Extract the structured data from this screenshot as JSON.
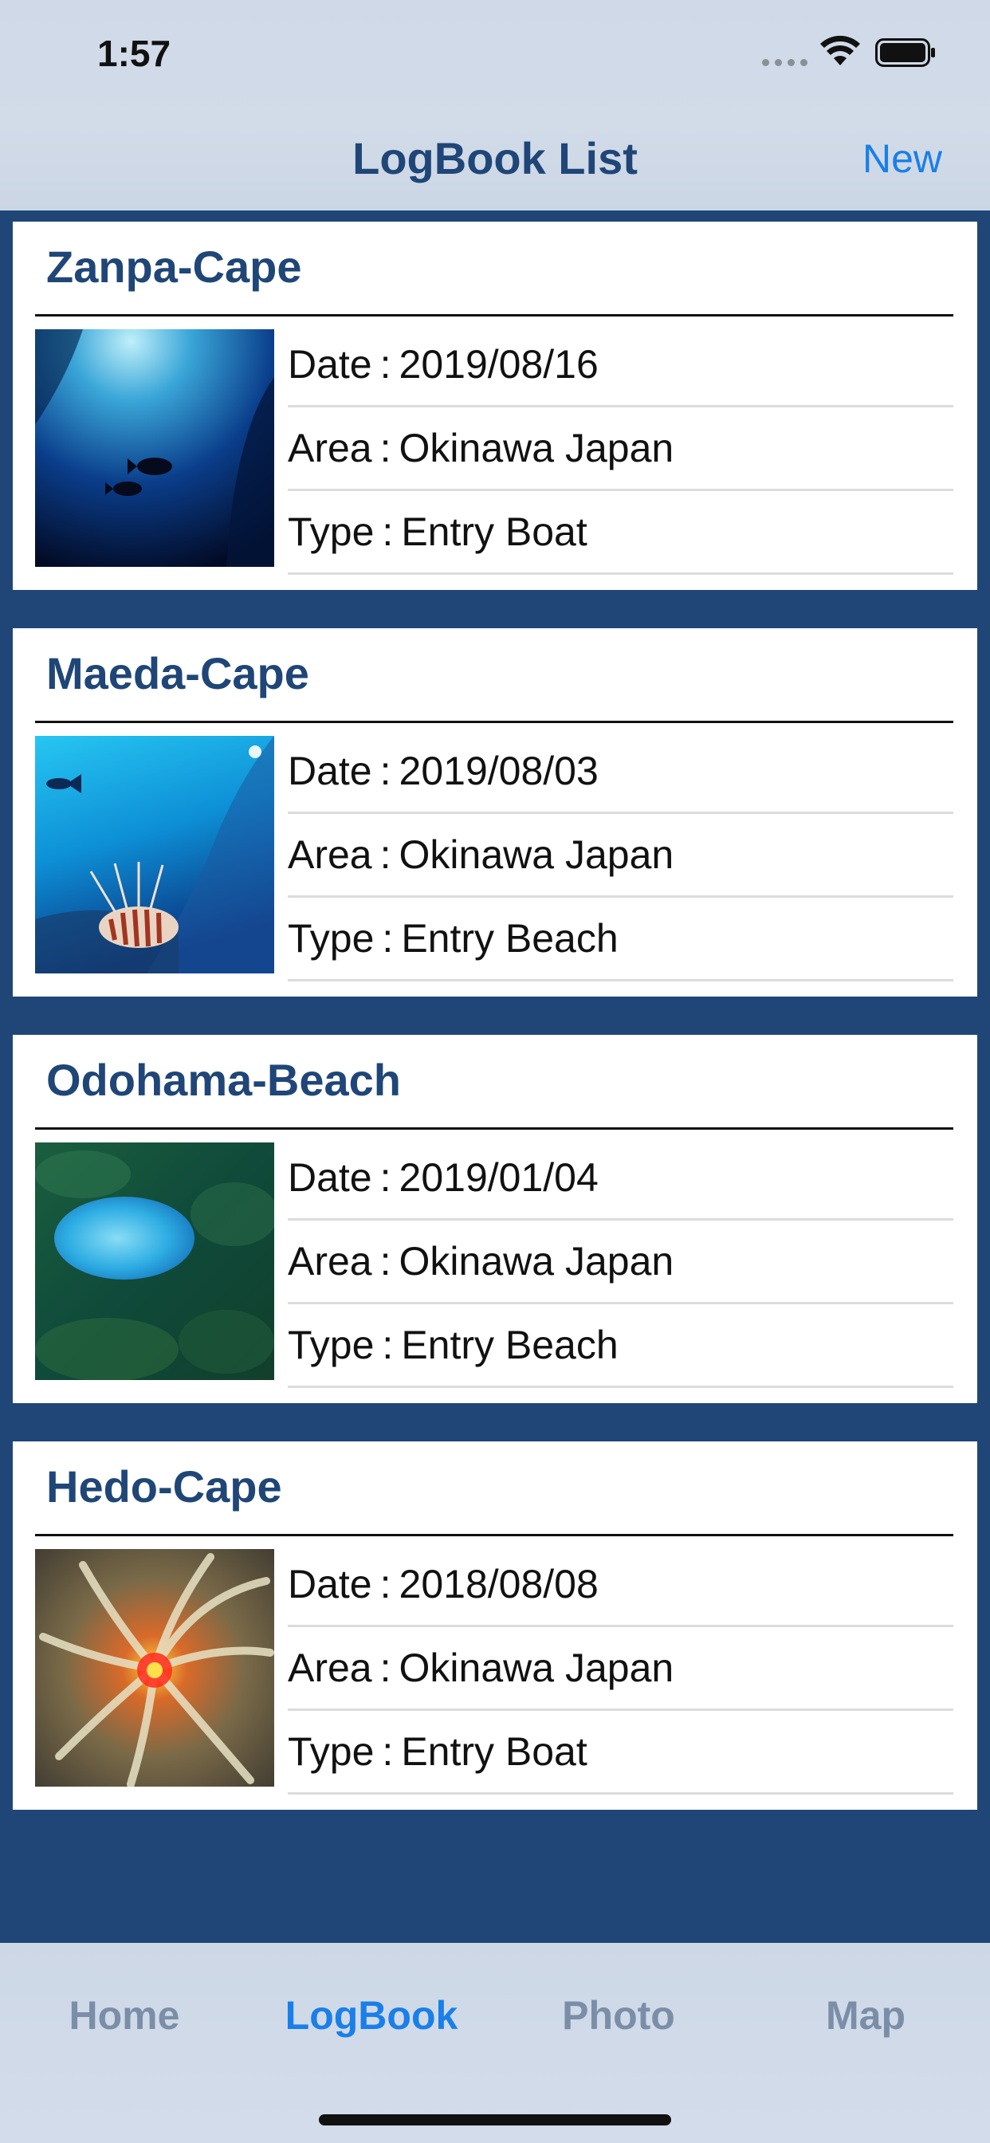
{
  "status_bar": {
    "time": "1:57"
  },
  "nav": {
    "title": "LogBook List",
    "new_label": "New"
  },
  "logs": [
    {
      "name": "Zanpa-Cape",
      "date_label": "Date",
      "date": "2019/08/16",
      "area_label": "Area",
      "area": "Okinawa Japan",
      "type_label": "Type",
      "type": "Entry Boat",
      "photo": "fish-silhouettes-photo"
    },
    {
      "name": "Maeda-Cape",
      "date_label": "Date",
      "date": "2019/08/03",
      "area_label": "Area",
      "area": "Okinawa Japan",
      "type_label": "Type",
      "type": "Entry Beach",
      "photo": "lionfish-photo"
    },
    {
      "name": "Odohama-Beach",
      "date_label": "Date",
      "date": "2019/01/04",
      "area_label": "Area",
      "area": "Okinawa Japan",
      "type_label": "Type",
      "type": "Entry Beach",
      "photo": "jellyfish-photo"
    },
    {
      "name": "Hedo-Cape",
      "date_label": "Date",
      "date": "2018/08/08",
      "area_label": "Area",
      "area": "Okinawa Japan",
      "type_label": "Type",
      "type": "Entry Boat",
      "photo": "anemone-photo"
    }
  ],
  "tabs": [
    {
      "label": "Home",
      "active": false
    },
    {
      "label": "LogBook",
      "active": true
    },
    {
      "label": "Photo",
      "active": false
    },
    {
      "label": "Map",
      "active": false
    }
  ],
  "colors": {
    "accent": "#1a7fe8",
    "brand_navy": "#1f4677",
    "inactive_tab": "#7b8ea8"
  }
}
